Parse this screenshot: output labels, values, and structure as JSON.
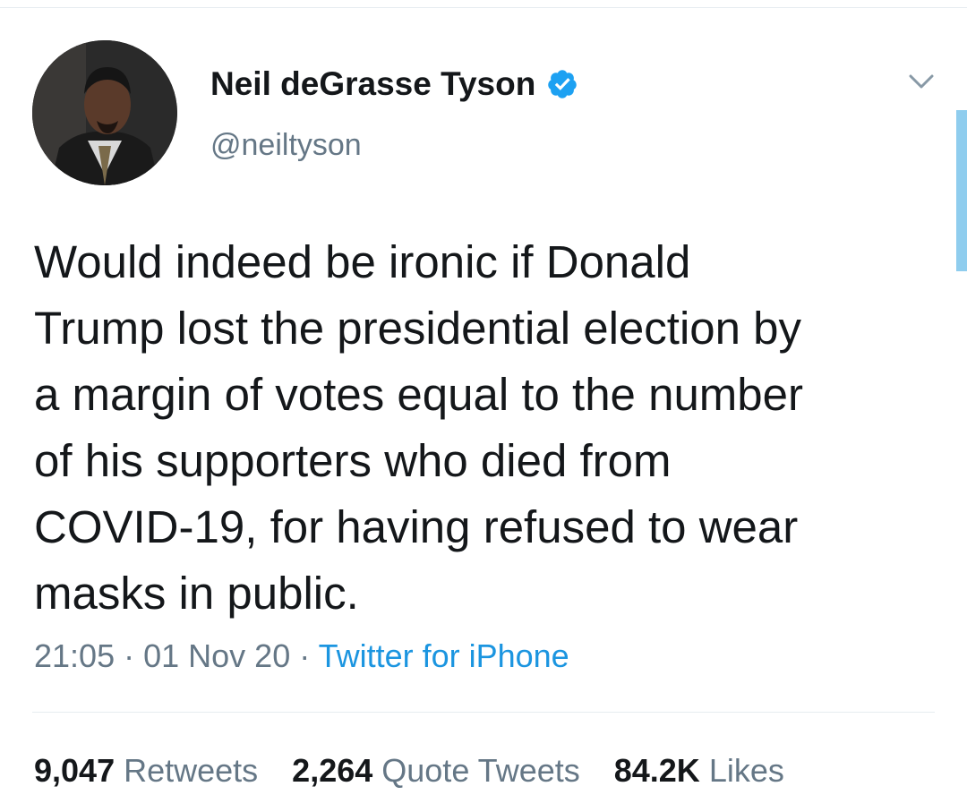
{
  "tweet": {
    "author": {
      "display_name": "Neil deGrasse Tyson",
      "handle": "@neiltyson",
      "verified": true,
      "avatar_icon": "profile-photo"
    },
    "text_lines": [
      "Would indeed be ironic if Donald",
      "Trump lost the presidential election by",
      "a margin of votes equal to the number",
      "of his supporters who died from",
      "COVID-19, for having refused to wear",
      "masks in public."
    ],
    "time": "21:05",
    "separator": "·",
    "date": "01 Nov 20",
    "source": "Twitter for iPhone",
    "stats": {
      "retweets_count": "9,047",
      "retweets_label": "Retweets",
      "quote_tweets_count": "2,264",
      "quote_tweets_label": "Quote Tweets",
      "likes_count": "84.2K",
      "likes_label": "Likes"
    }
  },
  "icons": {
    "verified": "verified-badge-icon",
    "menu": "chevron-down-icon"
  },
  "colors": {
    "text": "#14171a",
    "secondary": "#657786",
    "link": "#1b95e0",
    "verified": "#1da1f2",
    "scroll_indicator": "#8fcdee"
  }
}
